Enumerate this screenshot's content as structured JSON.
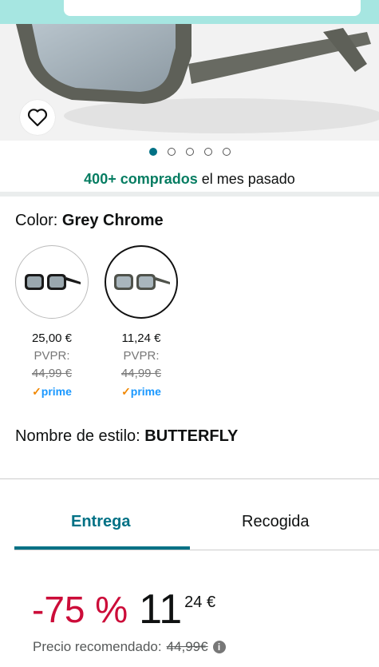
{
  "product": {
    "bought_bold": "400+ comprados",
    "bought_rest": " el mes pasado",
    "carousel_pages": 5,
    "carousel_active": 1
  },
  "color": {
    "label": "Color: ",
    "value": "Grey Chrome",
    "options": [
      {
        "price": "25,00 €",
        "pvpr_label": "PVPR:",
        "pvpr": "44,99 €",
        "prime": "prime"
      },
      {
        "price": "11,24 €",
        "pvpr_label": "PVPR:",
        "pvpr": "44,99 €",
        "prime": "prime"
      }
    ]
  },
  "style": {
    "label": "Nombre de estilo: ",
    "value": "BUTTERFLY"
  },
  "tabs": {
    "delivery": "Entrega",
    "pickup": "Recogida"
  },
  "price": {
    "discount": "-75 %",
    "whole": "11",
    "fraction": "24 €",
    "recommended_label": "Precio recomendado: ",
    "recommended_value": "44,99€"
  },
  "colors": {
    "teal": "#007185",
    "deal_red": "#cc0c39",
    "bought_green": "#067d62",
    "header": "#a6e6e1"
  }
}
